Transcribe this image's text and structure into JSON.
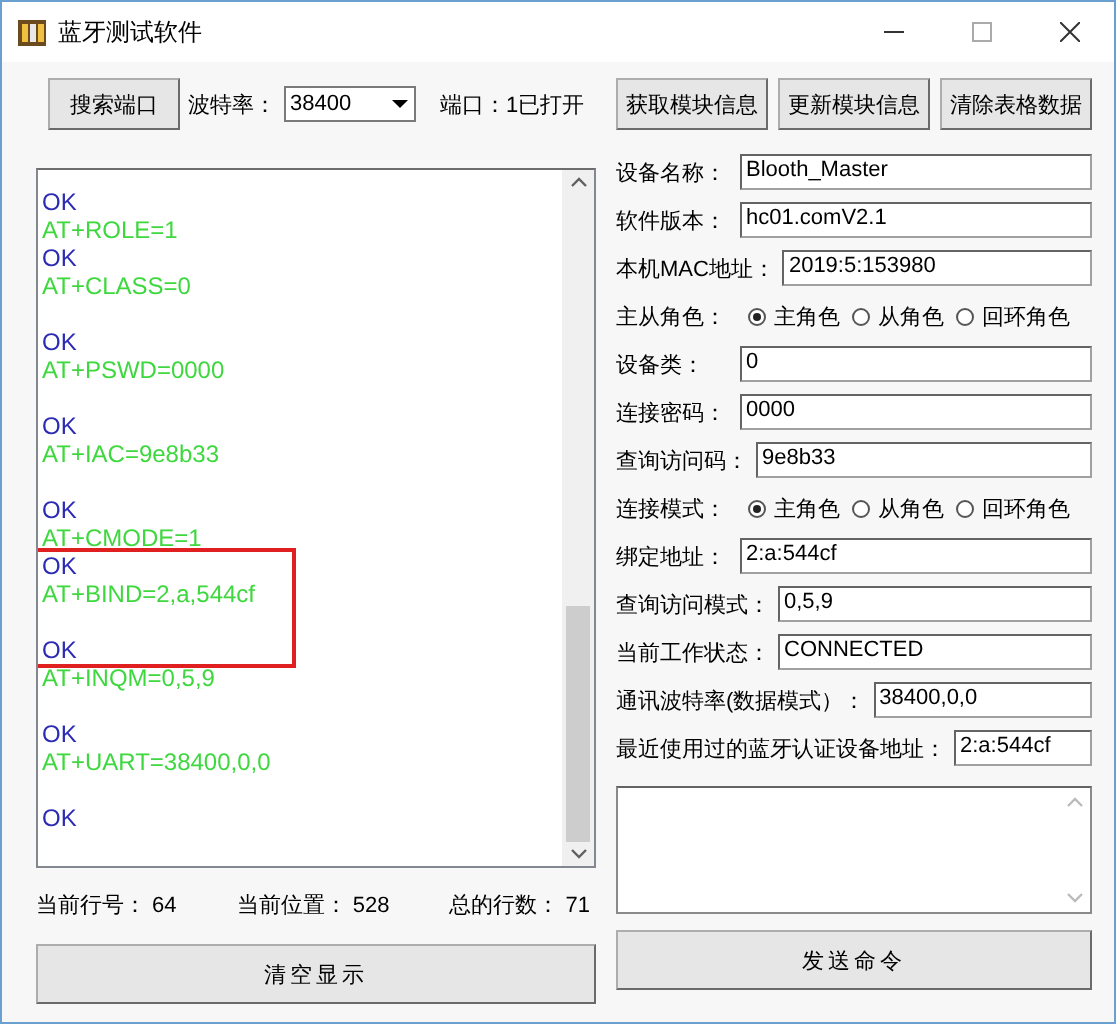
{
  "window": {
    "title": "蓝牙测试软件"
  },
  "toolbar": {
    "search_button": "搜索端口",
    "baud_label": "波特率：",
    "baud_value": "38400",
    "port_status": "端口：1已打开"
  },
  "log": {
    "lines": [
      {
        "kind": "response",
        "text": "OK",
        "marked": false
      },
      {
        "kind": "command",
        "text": "AT+ROLE=1",
        "marked": false
      },
      {
        "kind": "response",
        "text": "OK",
        "marked": false
      },
      {
        "kind": "command",
        "text": "AT+CLASS=0",
        "marked": false
      },
      {
        "kind": "blank",
        "marked": false
      },
      {
        "kind": "response",
        "text": "OK",
        "marked": false
      },
      {
        "kind": "command",
        "text": "AT+PSWD=0000",
        "marked": false
      },
      {
        "kind": "blank",
        "marked": false
      },
      {
        "kind": "response",
        "text": "OK",
        "marked": false
      },
      {
        "kind": "command",
        "text": "AT+IAC=9e8b33",
        "marked": false
      },
      {
        "kind": "blank",
        "marked": false
      },
      {
        "kind": "response",
        "text": "OK",
        "marked": false
      },
      {
        "kind": "command",
        "text": "AT+CMODE=1",
        "marked": false
      },
      {
        "kind": "response",
        "text": "OK",
        "marked": true
      },
      {
        "kind": "command",
        "text": "AT+BIND=2,a,544cf",
        "marked": true
      },
      {
        "kind": "blank",
        "marked": true
      },
      {
        "kind": "response",
        "text": "OK",
        "marked": true
      },
      {
        "kind": "command",
        "text": "AT+INQM=0,5,9",
        "marked": false
      },
      {
        "kind": "blank",
        "marked": false
      },
      {
        "kind": "response",
        "text": "OK",
        "marked": false
      },
      {
        "kind": "command",
        "text": "AT+UART=38400,0,0",
        "marked": false
      },
      {
        "kind": "blank",
        "marked": false
      },
      {
        "kind": "response",
        "text": "OK",
        "marked": false
      }
    ]
  },
  "status": [
    {
      "label": "当前行号：",
      "value": "64"
    },
    {
      "label": "当前位置：",
      "value": "528"
    },
    {
      "label": "总的行数：",
      "value": "71"
    }
  ],
  "clear_button": "清空显示",
  "info_buttons": [
    "获取模块信息",
    "更新模块信息",
    "清除表格数据"
  ],
  "fields": [
    {
      "kind": "text",
      "label": "设备名称：",
      "value": "Blooth_Master"
    },
    {
      "kind": "text",
      "label": "软件版本：",
      "value": "hc01.comV2.1"
    },
    {
      "kind": "text",
      "label": "本机MAC地址：",
      "value": "2019:5:153980"
    },
    {
      "kind": "radio",
      "label": "主从角色：",
      "options": [
        {
          "label": "主角色",
          "selected": true
        },
        {
          "label": "从角色",
          "selected": false
        },
        {
          "label": "回环角色",
          "selected": false
        }
      ]
    },
    {
      "kind": "text",
      "label": "设备类：",
      "value": "0"
    },
    {
      "kind": "text",
      "label": "连接密码：",
      "value": "0000"
    },
    {
      "kind": "text",
      "label": "查询访问码：",
      "value": "9e8b33"
    },
    {
      "kind": "radio",
      "label": "连接模式：",
      "options": [
        {
          "label": "主角色",
          "selected": true
        },
        {
          "label": "从角色",
          "selected": false
        },
        {
          "label": "回环角色",
          "selected": false
        }
      ]
    },
    {
      "kind": "text",
      "label": "绑定地址：",
      "value": "2:a:544cf"
    },
    {
      "kind": "text",
      "label": "查询访问模式：",
      "value": "0,5,9"
    },
    {
      "kind": "text",
      "label": "当前工作状态：",
      "value": "CONNECTED"
    },
    {
      "kind": "text",
      "label": "通讯波特率(数据模式）：",
      "value": "38400,0,0"
    },
    {
      "kind": "text",
      "label": "最近使用过的蓝牙认证设备地址：",
      "value": "2:a:544cf"
    }
  ],
  "send_button": "发送命令"
}
